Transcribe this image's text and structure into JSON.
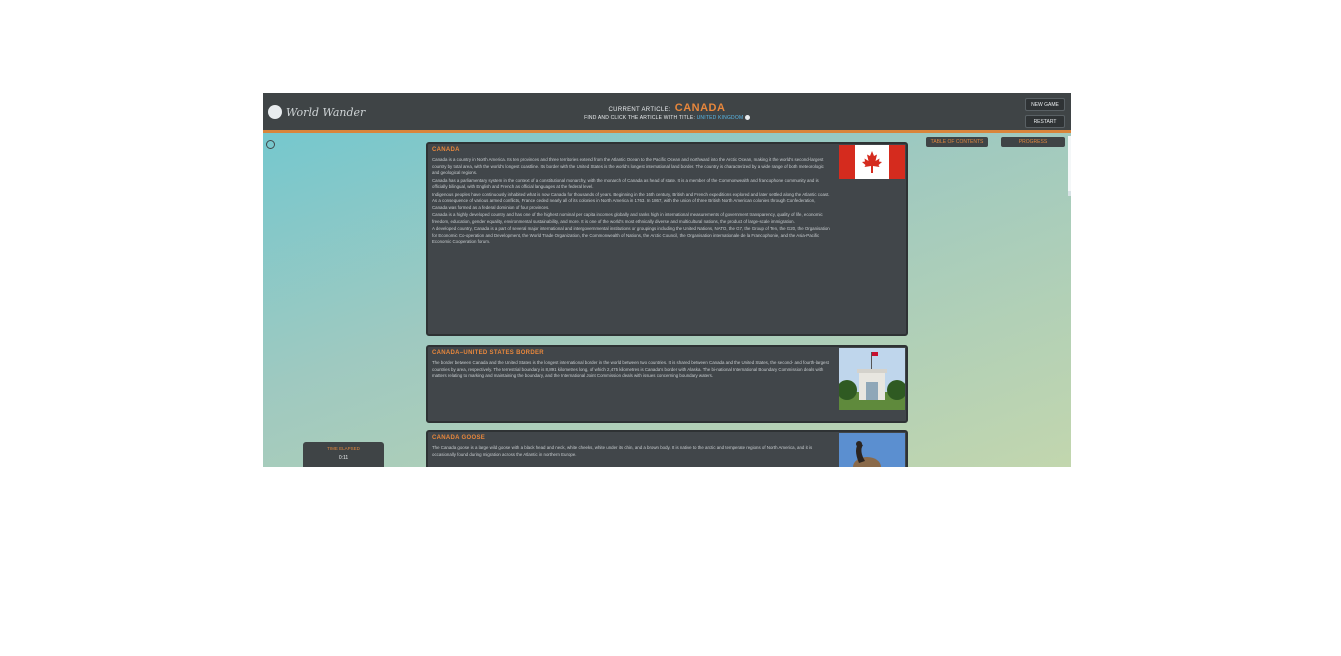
{
  "header": {
    "logo_text": "World Wander",
    "current_article_label": "CURRENT ARTICLE:",
    "current_article": "CANADA",
    "objective_prefix": "FIND AND CLICK THE ARTICLE WITH TITLE:",
    "objective_target": "UNITED KINGDOM",
    "new_game_label": "NEW GAME",
    "restart_label": "RESTART"
  },
  "side_buttons": {
    "table_label": "TABLE OF CONTENTS",
    "progress_label": "PROGRESS"
  },
  "articles": [
    {
      "title": "CANADA",
      "image": "flag-of-canada",
      "paragraphs": [
        "Canada is a country in North America. Its ten provinces and three territories extend from the Atlantic Ocean to the Pacific Ocean and northward into the Arctic Ocean, making it the world's second-largest country by total area, with the world's longest coastline. Its border with the United States is the world's longest international land border. The country is characterized by a wide range of both meteorologic and geological regions.",
        "Canada has a parliamentary system in the context of a constitutional monarchy, with the monarch of Canada as head of state. It is a member of the Commonwealth and francophone community and is officially bilingual, with English and French as official languages at the federal level.",
        "Indigenous peoples have continuously inhabited what is now Canada for thousands of years. Beginning in the 16th century, British and French expeditions explored and later settled along the Atlantic coast. As a consequence of various armed conflicts, France ceded nearly all of its colonies in North America in 1763. In 1867, with the union of three British North American colonies through Confederation, Canada was formed as a federal dominion of four provinces.",
        "Canada is a highly developed country and has one of the highest nominal per capita incomes globally and ranks high in international measurements of government transparency, quality of life, economic freedom, education, gender equality, environmental sustainability, and more. It is one of the world's most ethnically diverse and multicultural nations, the product of large-scale immigration.",
        "A developed country, Canada is a part of several major international and intergovernmental institutions or groupings including the United Nations, NATO, the G7, the Group of Ten, the G20, the Organisation for Economic Co-operation and Development, the World Trade Organization, the Commonwealth of Nations, the Arctic Council, the Organisation internationale de la Francophonie, and the Asia-Pacific Economic Cooperation forum."
      ]
    },
    {
      "title": "CANADA–UNITED STATES BORDER",
      "image": "peace-arch-monument",
      "paragraphs": [
        "The border between Canada and the United States is the longest international border in the world between two countries. It is shared between Canada and the United States, the second- and fourth-largest countries by area, respectively. The terrestrial boundary is 8,891 kilometres long, of which 2,475 kilometres is Canada's border with Alaska. The bi-national International Boundary Commission deals with matters relating to marking and maintaining the boundary, and the International Joint Commission deals with issues concerning boundary waters."
      ]
    },
    {
      "title": "CANADA GOOSE",
      "image": "canada-goose-photo",
      "paragraphs": [
        "The Canada goose is a large wild goose with a black head and neck, white cheeks, white under its chin, and a brown body. It is native to the arctic and temperate regions of North America, and it is occasionally found during migration across the Atlantic in northern Europe."
      ]
    }
  ],
  "bottom_widget": {
    "label": "TIME ELAPSED",
    "value": "0:11"
  },
  "colors": {
    "accent": "#e8873c",
    "panel": "#41464a",
    "link": "#59b7e6"
  }
}
